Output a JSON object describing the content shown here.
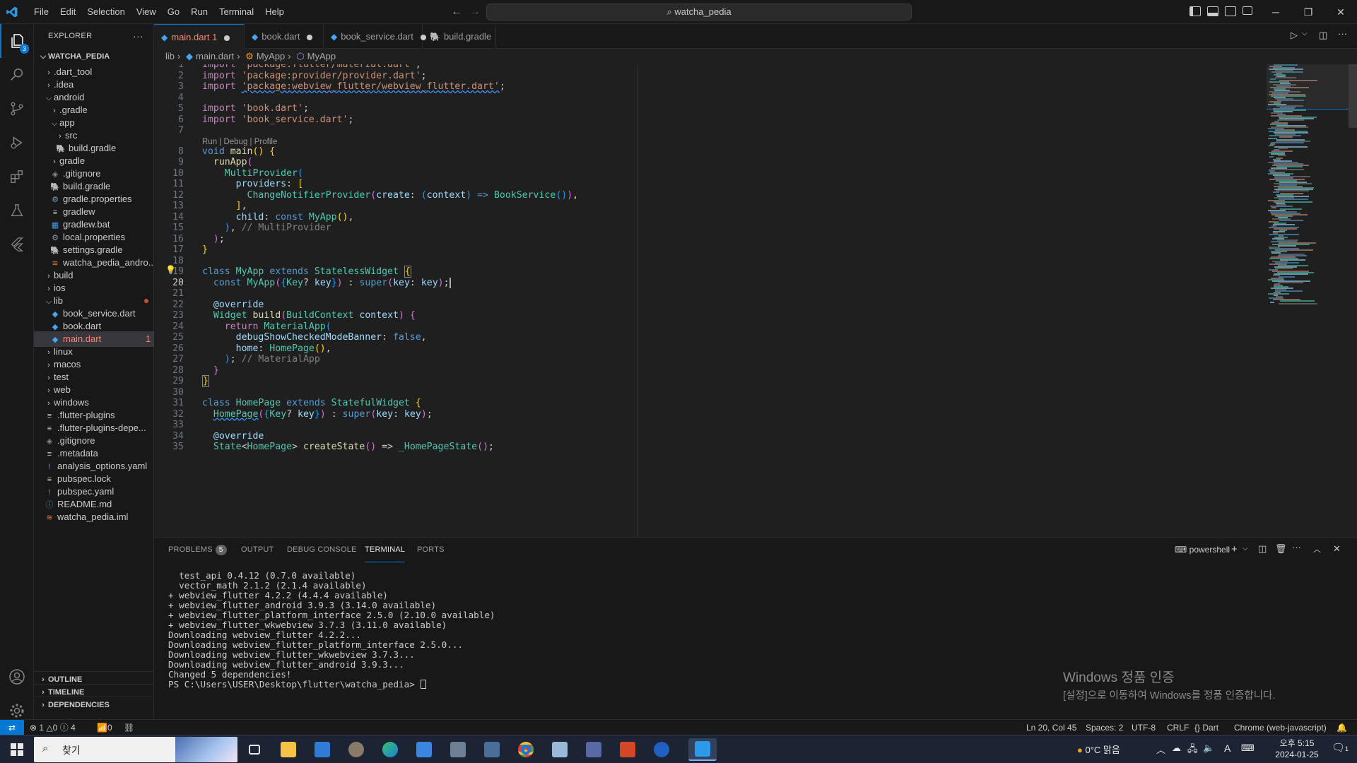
{
  "menu": [
    "File",
    "Edit",
    "Selection",
    "View",
    "Go",
    "Run",
    "Terminal",
    "Help"
  ],
  "search": {
    "label": "watcha_pedia"
  },
  "explorer": {
    "title": "EXPLORER",
    "root": "WATCHA_PEDIA",
    "items": [
      {
        "label": ".dart_tool",
        "kind": "folder",
        "depth": 1,
        "open": false
      },
      {
        "label": ".idea",
        "kind": "folder",
        "depth": 1,
        "open": false
      },
      {
        "label": "android",
        "kind": "folder",
        "depth": 1,
        "open": true
      },
      {
        "label": ".gradle",
        "kind": "folder",
        "depth": 2,
        "open": false
      },
      {
        "label": "app",
        "kind": "folder",
        "depth": 2,
        "open": true
      },
      {
        "label": "src",
        "kind": "folder",
        "depth": 3,
        "open": false
      },
      {
        "label": "build.gradle",
        "kind": "gradle",
        "depth": 3
      },
      {
        "label": "gradle",
        "kind": "folder",
        "depth": 2,
        "open": false
      },
      {
        "label": ".gitignore",
        "kind": "git",
        "depth": 2
      },
      {
        "label": "build.gradle",
        "kind": "gradle",
        "depth": 2
      },
      {
        "label": "gradle.properties",
        "kind": "gear",
        "depth": 2
      },
      {
        "label": "gradlew",
        "kind": "file",
        "depth": 2
      },
      {
        "label": "gradlew.bat",
        "kind": "win",
        "depth": 2
      },
      {
        "label": "local.properties",
        "kind": "gear",
        "depth": 2
      },
      {
        "label": "settings.gradle",
        "kind": "gradle",
        "depth": 2
      },
      {
        "label": "watcha_pedia_andro...",
        "kind": "rss",
        "depth": 2
      },
      {
        "label": "build",
        "kind": "folder",
        "depth": 1,
        "open": false
      },
      {
        "label": "ios",
        "kind": "folder",
        "depth": 1,
        "open": false
      },
      {
        "label": "lib",
        "kind": "folder",
        "depth": 1,
        "open": true,
        "status": "modified"
      },
      {
        "label": "book_service.dart",
        "kind": "dart",
        "depth": 2
      },
      {
        "label": "book.dart",
        "kind": "dart",
        "depth": 2
      },
      {
        "label": "main.dart",
        "kind": "dart",
        "depth": 2,
        "selected": true,
        "problems": "1"
      },
      {
        "label": "linux",
        "kind": "folder",
        "depth": 1,
        "open": false
      },
      {
        "label": "macos",
        "kind": "folder",
        "depth": 1,
        "open": false
      },
      {
        "label": "test",
        "kind": "folder",
        "depth": 1,
        "open": false
      },
      {
        "label": "web",
        "kind": "folder",
        "depth": 1,
        "open": false
      },
      {
        "label": "windows",
        "kind": "folder",
        "depth": 1,
        "open": false
      },
      {
        "label": ".flutter-plugins",
        "kind": "file",
        "depth": 1
      },
      {
        "label": ".flutter-plugins-depe...",
        "kind": "file",
        "depth": 1
      },
      {
        "label": ".gitignore",
        "kind": "git",
        "depth": 1
      },
      {
        "label": ".metadata",
        "kind": "file",
        "depth": 1
      },
      {
        "label": "analysis_options.yaml",
        "kind": "yaml",
        "depth": 1
      },
      {
        "label": "pubspec.lock",
        "kind": "file",
        "depth": 1
      },
      {
        "label": "pubspec.yaml",
        "kind": "yaml",
        "depth": 1
      },
      {
        "label": "README.md",
        "kind": "info",
        "depth": 1
      },
      {
        "label": "watcha_pedia.iml",
        "kind": "rss",
        "depth": 1
      }
    ],
    "sections": [
      "OUTLINE",
      "TIMELINE",
      "DEPENDENCIES"
    ]
  },
  "tabs": [
    {
      "label": "main.dart",
      "suffix": "1",
      "dirty": true,
      "active": true
    },
    {
      "label": "book.dart",
      "dirty": true
    },
    {
      "label": "book_service.dart",
      "dirty": true
    },
    {
      "label": "build.gradle",
      "dirty": false
    }
  ],
  "breadcrumb": [
    "lib",
    "main.dart",
    "MyApp",
    "MyApp"
  ],
  "editor": {
    "code_lens": "Run | Debug | Profile",
    "current_line": 20
  },
  "panel": {
    "tabs": [
      {
        "label": "PROBLEMS",
        "badge": "5"
      },
      {
        "label": "OUTPUT"
      },
      {
        "label": "DEBUG CONSOLE"
      },
      {
        "label": "TERMINAL",
        "active": true
      },
      {
        "label": "PORTS"
      }
    ],
    "shell": "powershell",
    "terminal_lines": [
      "  test_api 0.4.12 (0.7.0 available)",
      "  vector_math 2.1.2 (2.1.4 available)",
      "+ webview_flutter 4.2.2 (4.4.4 available)",
      "+ webview_flutter_android 3.9.3 (3.14.0 available)",
      "+ webview_flutter_platform_interface 2.5.0 (2.10.0 available)",
      "+ webview_flutter_wkwebview 3.7.3 (3.11.0 available)",
      "Downloading webview_flutter 4.2.2...",
      "Downloading webview_flutter_platform_interface 2.5.0...",
      "Downloading webview_flutter_wkwebview 3.7.3...",
      "Downloading webview_flutter_android 3.9.3...",
      "Changed 5 dependencies!",
      "PS C:\\Users\\USER\\Desktop\\flutter\\watcha_pedia> "
    ],
    "watermark_title": "Windows 정품 인증",
    "watermark_sub": "[설정]으로 이동하여 Windows를 정품 인증합니다."
  },
  "statusbar": {
    "errors": "1",
    "warnings": "0",
    "infos": "4",
    "ports": "0",
    "position": "Ln 20, Col 45",
    "spaces": "Spaces: 2",
    "encoding": "UTF-8",
    "eol": "CRLF",
    "language": "Dart",
    "device": "Chrome (web-javascript)"
  },
  "taskbar": {
    "search": "찾기",
    "weather": "0°C 맑음",
    "time": "오후 5:15",
    "date": "2024-01-25",
    "notif_count": "1",
    "ime": "A"
  },
  "colors": {
    "accent": "#0078d4",
    "dart": "#42a5f5"
  }
}
